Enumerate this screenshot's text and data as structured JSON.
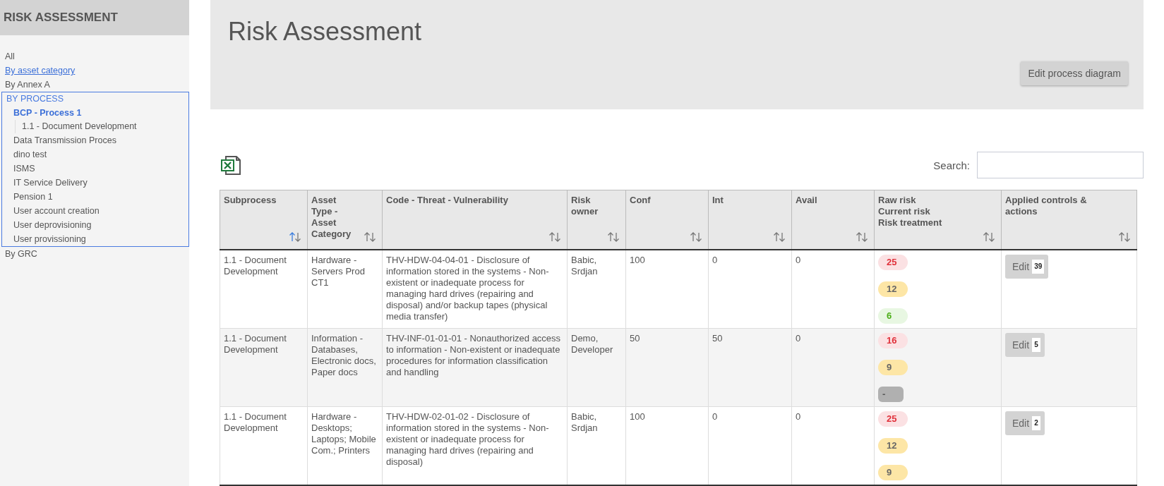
{
  "sidebar": {
    "title": "RISK ASSESSMENT",
    "items": [
      {
        "label": "All",
        "kind": "plain",
        "selected": false
      },
      {
        "label": "By asset category",
        "kind": "link",
        "selected": false
      },
      {
        "label": "By Annex A",
        "kind": "plain",
        "selected": false
      },
      {
        "label": "BY PROCESS",
        "kind": "group",
        "selected": true,
        "expanded": true,
        "children": [
          {
            "label": "BCP - Process 1",
            "selected": true,
            "children": [
              {
                "label": "1.1 - Document Development",
                "selected": false
              }
            ]
          },
          {
            "label": "Data Transmission Proces",
            "selected": false
          },
          {
            "label": "dino test",
            "selected": false
          },
          {
            "label": "ISMS",
            "selected": false
          },
          {
            "label": "IT Service Delivery",
            "selected": false
          },
          {
            "label": "Pension 1",
            "selected": false
          },
          {
            "label": "User account creation",
            "selected": false
          },
          {
            "label": "User deprovisioning",
            "selected": false
          },
          {
            "label": "User provissioning",
            "selected": false
          }
        ]
      },
      {
        "label": "By GRC",
        "kind": "plain",
        "selected": false
      }
    ]
  },
  "header": {
    "title": "Risk Assessment",
    "button": "Edit process diagram"
  },
  "search": {
    "label": "Search:"
  },
  "table": {
    "columns": [
      {
        "label": "Subprocess",
        "sorted": true
      },
      {
        "label": "Asset Type - Asset Category",
        "sorted": false
      },
      {
        "label": "Code - Threat - Vulnerability",
        "sorted": false
      },
      {
        "label": "Risk owner",
        "sorted": false
      },
      {
        "label": "Conf",
        "sorted": false
      },
      {
        "label": "Int",
        "sorted": false
      },
      {
        "label": "Avail",
        "sorted": false
      },
      {
        "label": "Raw risk\nCurrent risk\nRisk treatment",
        "sorted": false
      },
      {
        "label": "Applied controls & actions",
        "sorted": false
      }
    ],
    "rows": [
      {
        "subprocess": "1.1 - Document Development",
        "asset": "Hardware - Servers Prod CT1",
        "threat": "THV-HDW-04-04-01 - Disclosure of information stored in the systems - Non-existent or inadequate process for managing hard drives (repairing and disposal) and/or backup tapes (physical media transfer)",
        "owner": "Babic, Srdjan",
        "conf": "100",
        "int": "0",
        "avail": "0",
        "risks": [
          {
            "value": "25",
            "kind": "high"
          },
          {
            "value": "12",
            "kind": "medium"
          },
          {
            "value": "6",
            "kind": "low"
          }
        ],
        "edit": "Edit",
        "count": "39"
      },
      {
        "subprocess": "1.1 - Document Development",
        "asset": "Information - Databases, Electronic docs, Paper docs",
        "threat": "THV-INF-01-01-01 - Nonauthorized access to information - Non-existent or inadequate procedures for information classification and handling",
        "owner": "Demo, Developer",
        "conf": "50",
        "int": "50",
        "avail": "0",
        "risks": [
          {
            "value": "16",
            "kind": "high"
          },
          {
            "value": "9",
            "kind": "medium"
          },
          {
            "value": "-",
            "kind": "none"
          }
        ],
        "edit": "Edit",
        "count": "5"
      },
      {
        "subprocess": "1.1 - Document Development",
        "asset": "Hardware - Desktops; Laptops; Mobile Com.; Printers",
        "threat": "THV-HDW-02-01-02 - Disclosure of information stored in the systems - Non-existent or inadequate process for managing hard drives (repairing and disposal)",
        "owner": "Babic, Srdjan",
        "conf": "100",
        "int": "0",
        "avail": "0",
        "risks": [
          {
            "value": "25",
            "kind": "high"
          },
          {
            "value": "12",
            "kind": "medium"
          },
          {
            "value": "9",
            "kind": "medium"
          }
        ],
        "edit": "Edit",
        "count": "2"
      }
    ]
  }
}
